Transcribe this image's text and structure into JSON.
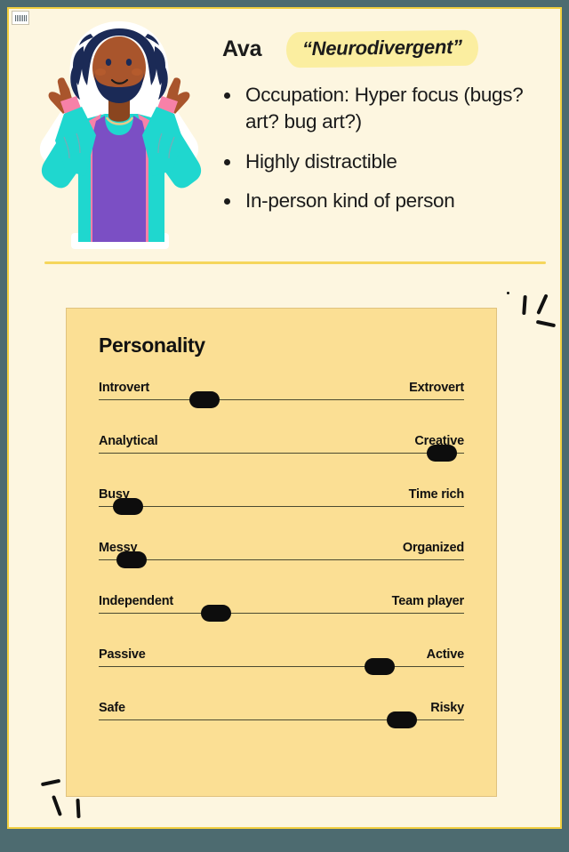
{
  "persona": {
    "name": "Ava",
    "quote": "“Neurodivergent”",
    "traits": [
      "Occupation: Hyper focus (bugs? art? bug art?)",
      "Highly distractible",
      "In-person kind of person"
    ]
  },
  "personality": {
    "title": "Personality",
    "sliders": [
      {
        "left_label": "Introvert",
        "right_label": "Extrovert",
        "value": 29
      },
      {
        "left_label": "Analytical",
        "right_label": "Creative",
        "value": 94
      },
      {
        "left_label": "Busy",
        "right_label": "Time rich",
        "value": 8
      },
      {
        "left_label": "Messy",
        "right_label": "Organized",
        "value": 9
      },
      {
        "left_label": "Independent",
        "right_label": "Team player",
        "value": 32
      },
      {
        "left_label": "Passive",
        "right_label": "Active",
        "value": 77
      },
      {
        "left_label": "Safe",
        "right_label": "Risky",
        "value": 83
      }
    ]
  },
  "theme": {
    "outer_frame": "#4d6b70",
    "page_background": "#fdf6e0",
    "page_border": "#f2cf3f",
    "card_background": "#fbdf94",
    "card_border": "#e0c27e",
    "highlight": "#fbeea0",
    "divider": "#f5d65c",
    "thumb": "#0d0d0d",
    "text": "#1b1b1b"
  },
  "avatar": {
    "alt": "illustrated portrait of a person shrugging with raised hands",
    "hair_color": "#1b2a56",
    "skin_color": "#a9552c",
    "jacket_color": "#1fd7cf",
    "inner_color": "#f781a8",
    "top_color": "#7b4fc4",
    "sticker_outline": "#ffffff"
  },
  "decor": {
    "sparkle_top_right": "sparkle-marks",
    "sparkle_bottom_left": "sparkle-marks",
    "corner_stamp": "stamp-icon"
  }
}
